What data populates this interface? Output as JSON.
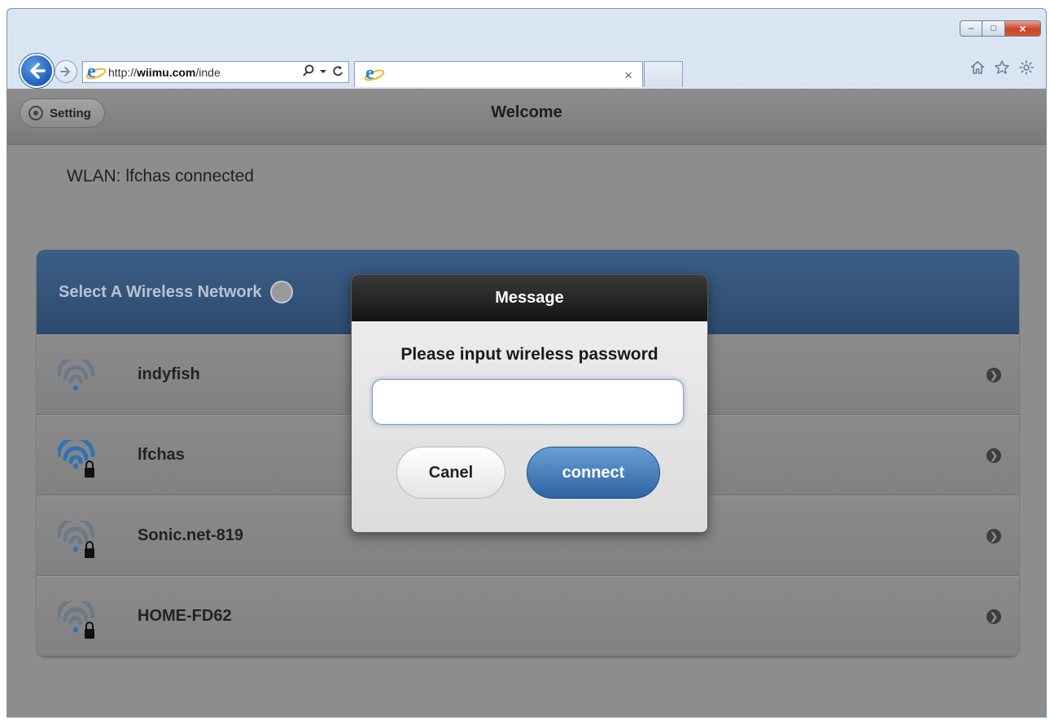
{
  "browser": {
    "address_prefix": "http://",
    "address_domain": "wiimu.com",
    "address_suffix": "/inde",
    "tab_close": "×",
    "window_controls": {
      "minimize": "–",
      "maximize": "□",
      "close": "×"
    },
    "icons": [
      "back-arrow-icon",
      "forward-arrow-icon",
      "ie-logo-icon",
      "search-icon",
      "dropdown-icon",
      "refresh-icon",
      "home-icon",
      "favorites-star-icon",
      "settings-gear-icon"
    ]
  },
  "page": {
    "setting_label": "Setting",
    "title": "Welcome",
    "wlan_status": "WLAN: lfchas connected"
  },
  "network_panel": {
    "heading": "Select A Wireless Network",
    "networks": [
      {
        "name": "indyfish",
        "signal": "weak",
        "locked": false
      },
      {
        "name": "lfchas",
        "signal": "full",
        "locked": true
      },
      {
        "name": "Sonic.net-819",
        "signal": "weak",
        "locked": true
      },
      {
        "name": "HOME-FD62",
        "signal": "weak",
        "locked": true
      }
    ]
  },
  "modal": {
    "title": "Message",
    "prompt": "Please input wireless password",
    "password_value": "",
    "cancel_label": "Canel",
    "connect_label": "connect"
  },
  "colors": {
    "panel_header": "#2d4a6e",
    "wifi_active": "#2f73b5",
    "wifi_inactive": "#6c7986",
    "connect_button": "#2c64a3",
    "page_background": "#8d8d8d"
  }
}
